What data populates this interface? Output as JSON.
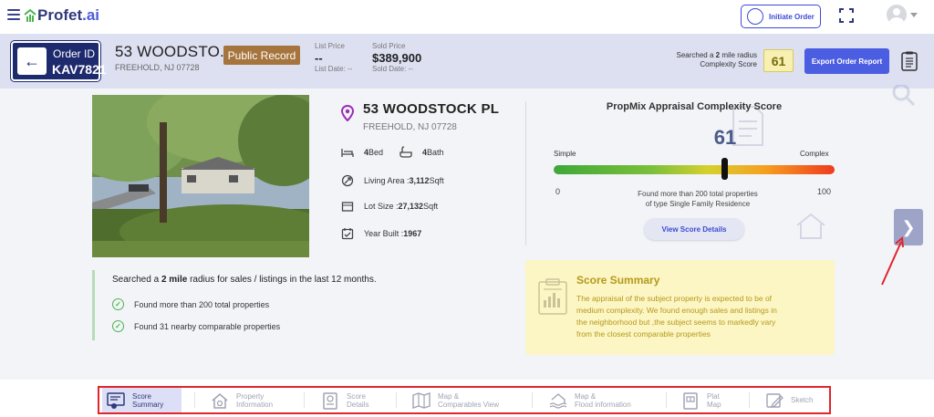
{
  "app": {
    "logo_text": "Profet",
    "logo_suffix": ".ai",
    "initiate_order_label": "Initiate Order"
  },
  "order": {
    "id_label": "Order ID",
    "id_value": "KAV7821",
    "address_short": "53 WOODSTO...",
    "city_state_zip": "FREEHOLD, NJ 07728",
    "badge": "Public Record",
    "list_price_label": "List Price",
    "list_price_value": "--",
    "list_date": "List Date: --",
    "sold_price_label": "Sold Price",
    "sold_price_value": "$389,900",
    "sold_date": "Sold Date: --",
    "radius_line1_pre": "Searched a ",
    "radius_bold": "2",
    "radius_line1_post": " mile radius",
    "radius_line2": "Complexity Score",
    "complexity_score": "61",
    "export_label": "Export Order Report"
  },
  "property": {
    "address": "53 WOODSTOCK PL",
    "city_state_zip": "FREEHOLD, NJ 07728",
    "beds_value": "4",
    "beds_label": " Bed",
    "baths_value": "4",
    "baths_label": " Bath",
    "living_area_label": "Living Area : ",
    "living_area_value": "3,112",
    "living_area_unit": " Sqft",
    "lot_size_label": "Lot Size : ",
    "lot_size_value": "27,132",
    "lot_size_unit": " Sqft",
    "year_built_label": "Year Built : ",
    "year_built_value": "1967"
  },
  "complexity": {
    "title": "PropMix Appraisal Complexity Score",
    "score": "61",
    "score_value": 61,
    "simple_label": "Simple",
    "complex_label": "Complex",
    "min": "0",
    "max": "100",
    "found_line1": "Found more than 200 total properties",
    "found_line2": "of type Single Family Residence",
    "view_details_label": "View Score Details"
  },
  "search_summary": {
    "title_pre": "Searched a ",
    "title_bold": "2 mile",
    "title_post": " radius for sales / listings in the last 12 months.",
    "items": [
      "Found more than 200 total properties",
      "Found 31 nearby comparable properties"
    ]
  },
  "score_summary": {
    "title": "Score Summary",
    "lines": [
      "The appraisal of the subject property is expected to be of",
      "medium complexity. We found enough sales and listings in",
      "the neighborhood but ,the subject seems to markedly vary",
      "from the closest comparable properties"
    ]
  },
  "bottom_nav": {
    "items": [
      {
        "line1": "Score",
        "line2": "Summary",
        "icon": "score-summary-icon"
      },
      {
        "line1": "Property",
        "line2": "Information",
        "icon": "house-icon"
      },
      {
        "line1": "Score",
        "line2": "Details",
        "icon": "score-details-icon"
      },
      {
        "line1": "Map &",
        "line2": "Comparables View",
        "icon": "map-icon"
      },
      {
        "line1": "Map &",
        "line2": "Flood information",
        "icon": "flood-icon"
      },
      {
        "line1": "Plat",
        "line2": "Map",
        "icon": "plat-map-icon"
      },
      {
        "line1": "Sketch",
        "line2": "",
        "icon": "sketch-icon"
      }
    ]
  },
  "colors": {
    "brand_navy": "#1e2a6e",
    "accent_blue": "#4b5de0",
    "public_record_brown": "#a6743d",
    "highlight_red": "#e0252d"
  }
}
